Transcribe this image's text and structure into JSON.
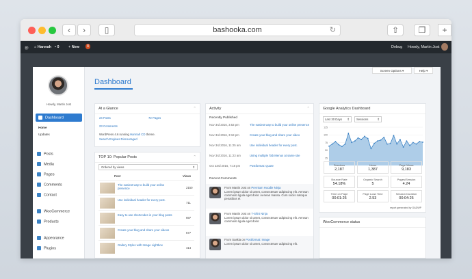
{
  "browser": {
    "url": "bashooka.com"
  },
  "adminbar": {
    "site": "Hannah",
    "comments": "0",
    "new": "New",
    "updates": "8",
    "debug": "Debug",
    "howdy": "Howdy, Martin Jost"
  },
  "top_buttons": {
    "screen_options": "Screen Options ▾",
    "help": "Help ▾"
  },
  "profile": {
    "howdy": "Howdy, Martin Jost"
  },
  "sidebar": {
    "dashboard": "Dashboard",
    "home": "Home",
    "updates": "Updates",
    "posts": "Posts",
    "media": "Media",
    "pages": "Pages",
    "comments": "Comments",
    "contact": "Contact",
    "woocommerce": "WooCommerce",
    "products": "Products",
    "appearance": "Appearance",
    "plugins": "Plugins"
  },
  "page_title": "Dashboard",
  "glance": {
    "title": "At a Glance",
    "posts": "24 Posts",
    "pages": "72 Pages",
    "comments": "23 Comments",
    "wp_prefix": "WordPress 4.6 running ",
    "theme": "Hannah CD",
    "wp_suffix": " theme.",
    "search": "Search Engines Discouraged"
  },
  "top10": {
    "title": "TOP 10: Popular Posts",
    "order": "Ordered by views",
    "col_post": "Post",
    "col_views": "Views",
    "rows": [
      {
        "title": "The easiest way to build your online presence",
        "views": "2150"
      },
      {
        "title": "Use individual header for every post.",
        "views": "711"
      },
      {
        "title": "Easy to use shortcodes in your blog posts",
        "views": "697"
      },
      {
        "title": "Create your blog and share your videos",
        "views": "677"
      },
      {
        "title": "Gallery Styles with Image Lightbox",
        "views": "414"
      }
    ]
  },
  "activity": {
    "title": "Activity",
    "recent_published": "Recently Published",
    "items": [
      {
        "date": "Nov 3rd 2016, 3:53 pm",
        "title": "The easiest way to build your online presence"
      },
      {
        "date": "Nov 3rd 2016, 3:18 pm",
        "title": "Create your blog and share your video"
      },
      {
        "date": "Nov 3rd 2016, 11:25 am",
        "title": "Use individual header for every post."
      },
      {
        "date": "Nov 3rd 2016, 11:23 am",
        "title": "Using multiple Tab Menus at same site"
      },
      {
        "date": "Oct 23rd 2016, 7:18 pm",
        "title": "Postformat: Quote"
      }
    ],
    "recent_comments": "Recent Comments",
    "comments": [
      {
        "from": "From Martin Jost on ",
        "post": "Premium Hoodie Ninja",
        "text": "Lorem ipsum dolor sit amet, consectetuer adipiscing elit. Aenean commodo ligula eget dolor. Aenean massa. Cum sociis natoque penatibus et"
      },
      {
        "from": "From Martin Jost on ",
        "post": "T-Shirt Ninja",
        "text": "Lorem ipsum dolor sit amet, consectetuer adipiscing elit. Aenean commodo ligula eget dolor."
      },
      {
        "from": "From Saskia on ",
        "post": "Postformat: Image",
        "text": "Lorem ipsum dolor sit amet, consectetuer adipiscing elit."
      }
    ]
  },
  "analytics": {
    "title": "Google Analytics Dashboard",
    "range": "Last 30 Days",
    "metric": "Sessions",
    "stats": [
      {
        "label": "Sessions",
        "value": "2,187"
      },
      {
        "label": "Users",
        "value": "1,387"
      },
      {
        "label": "Page Views",
        "value": "9,183"
      },
      {
        "label": "Bounce Rate",
        "value": "54.18%"
      },
      {
        "label": "Organic Search",
        "value": "5"
      },
      {
        "label": "Pages/Session",
        "value": "4.24"
      },
      {
        "label": "Time on Page",
        "value": "00:01:26"
      },
      {
        "label": "Page Load Time",
        "value": "2.53"
      },
      {
        "label": "Session Duration",
        "value": "00:04:26"
      }
    ],
    "footer": "report generated by GADWP",
    "next_title": "WooCommerce status"
  },
  "chart_data": {
    "type": "area",
    "ylim": [
      0,
      125
    ],
    "yticks": [
      "125",
      "100",
      "75",
      "50",
      "25"
    ],
    "values": [
      63,
      70,
      78,
      68,
      62,
      70,
      105,
      75,
      80,
      90,
      85,
      95,
      88,
      55,
      72,
      80,
      83,
      92,
      70,
      72,
      98,
      70,
      85,
      60,
      80,
      65,
      75,
      70,
      78,
      76
    ]
  }
}
